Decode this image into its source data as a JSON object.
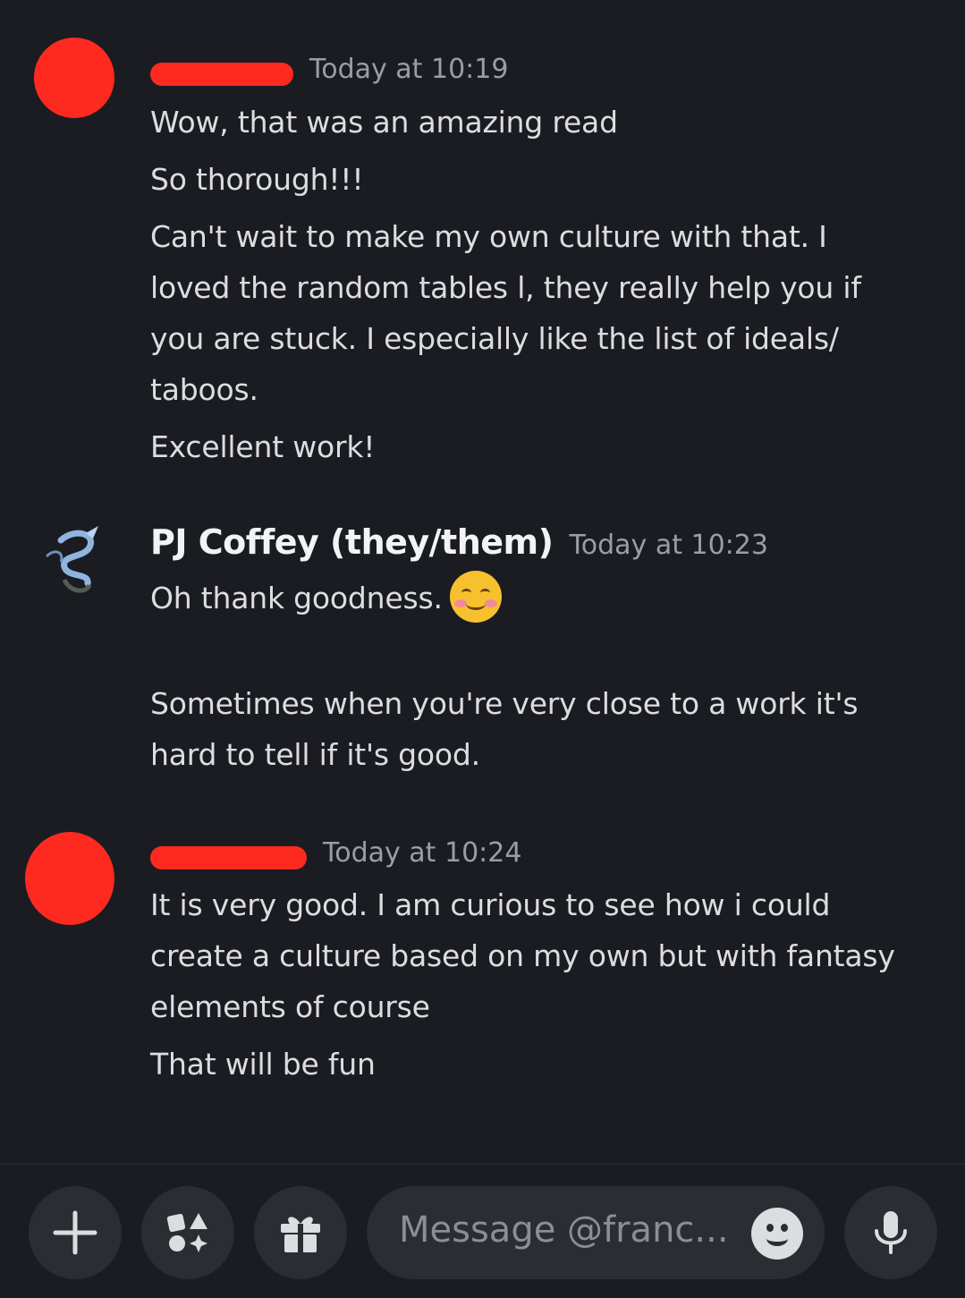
{
  "messages": [
    {
      "username": "",
      "timestamp": "Today at 10:19",
      "lines": [
        "Wow, that was an amazing read",
        "So thorough!!!",
        "Can't wait to make my own culture with that. I",
        "loved the random tables l, they really help you if",
        "you are stuck. I especially like the list of ideals/",
        "taboos.",
        "Excellent work!"
      ]
    },
    {
      "username": "PJ Coffey (they/them)",
      "timestamp": "Today at 10:23",
      "lines": [
        "Oh thank goodness.",
        "Sometimes when you're very close to a work it's",
        "hard to tell if it's good."
      ],
      "emoji": "smiling-face-with-smiling-eyes"
    },
    {
      "username": "",
      "timestamp": "Today at 10:24",
      "lines": [
        "It is very good. I am curious to see how i could",
        "create a culture based on my own but with fantasy",
        "elements of course",
        "That will be fun"
      ]
    }
  ],
  "composer": {
    "placeholder": "Message @franc...",
    "buttons": [
      "plus-icon",
      "apps-icon",
      "gift-icon",
      "emoji-icon",
      "microphone-icon"
    ]
  },
  "colors": {
    "background": "#1b1c21",
    "text": "#dcdde1",
    "username": "#f2f3f5",
    "timestamp": "#9b9ca7",
    "redaction": "#ff2a1f",
    "button": "#2b2d33"
  }
}
